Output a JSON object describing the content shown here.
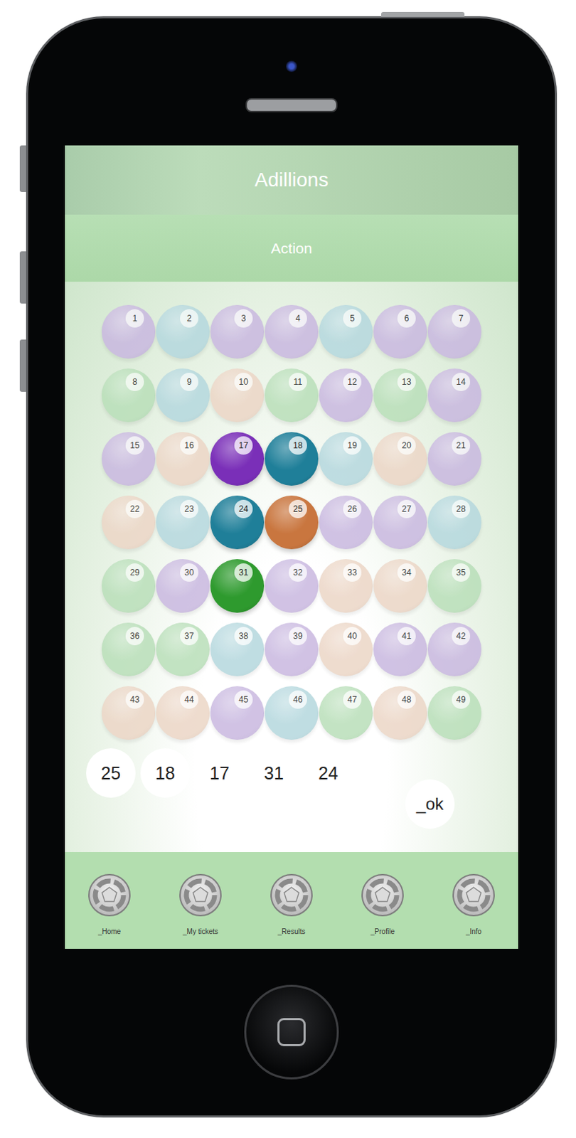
{
  "app": {
    "title": "Adillions",
    "subtitle": "Action"
  },
  "balls": [
    {
      "number": "1",
      "color": "#c9b8e0",
      "selected": false
    },
    {
      "number": "2",
      "color": "#b5d8de",
      "selected": false
    },
    {
      "number": "3",
      "color": "#c9b8e0",
      "selected": false
    },
    {
      "number": "4",
      "color": "#c9b8e0",
      "selected": false
    },
    {
      "number": "5",
      "color": "#b5d8de",
      "selected": false
    },
    {
      "number": "6",
      "color": "#c9b8e0",
      "selected": false
    },
    {
      "number": "7",
      "color": "#c9b8e0",
      "selected": false
    },
    {
      "number": "8",
      "color": "#b9dfb9",
      "selected": false
    },
    {
      "number": "9",
      "color": "#b5d8de",
      "selected": false
    },
    {
      "number": "10",
      "color": "#ecd6c6",
      "selected": false
    },
    {
      "number": "11",
      "color": "#b9dfb9",
      "selected": false
    },
    {
      "number": "12",
      "color": "#c9b8e0",
      "selected": false
    },
    {
      "number": "13",
      "color": "#b9dfb9",
      "selected": false
    },
    {
      "number": "14",
      "color": "#c9b8e0",
      "selected": false
    },
    {
      "number": "15",
      "color": "#c9b8e0",
      "selected": false
    },
    {
      "number": "16",
      "color": "#ecd6c6",
      "selected": false
    },
    {
      "number": "17",
      "color": "#7a2fb8",
      "selected": true
    },
    {
      "number": "18",
      "color": "#1f7f99",
      "selected": true
    },
    {
      "number": "19",
      "color": "#b5d8de",
      "selected": false
    },
    {
      "number": "20",
      "color": "#ecd6c6",
      "selected": false
    },
    {
      "number": "21",
      "color": "#c9b8e0",
      "selected": false
    },
    {
      "number": "22",
      "color": "#ecd6c6",
      "selected": false
    },
    {
      "number": "23",
      "color": "#b5d8de",
      "selected": false
    },
    {
      "number": "24",
      "color": "#1f7f99",
      "selected": true
    },
    {
      "number": "25",
      "color": "#c9763f",
      "selected": true
    },
    {
      "number": "26",
      "color": "#c9b8e0",
      "selected": false
    },
    {
      "number": "27",
      "color": "#c9b8e0",
      "selected": false
    },
    {
      "number": "28",
      "color": "#b5d8de",
      "selected": false
    },
    {
      "number": "29",
      "color": "#b9dfb9",
      "selected": false
    },
    {
      "number": "30",
      "color": "#c9b8e0",
      "selected": false
    },
    {
      "number": "31",
      "color": "#2e9a2e",
      "selected": true
    },
    {
      "number": "32",
      "color": "#c9b8e0",
      "selected": false
    },
    {
      "number": "33",
      "color": "#ecd6c6",
      "selected": false
    },
    {
      "number": "34",
      "color": "#ecd6c6",
      "selected": false
    },
    {
      "number": "35",
      "color": "#b9dfb9",
      "selected": false
    },
    {
      "number": "36",
      "color": "#b9dfb9",
      "selected": false
    },
    {
      "number": "37",
      "color": "#b9dfb9",
      "selected": false
    },
    {
      "number": "38",
      "color": "#b5d8de",
      "selected": false
    },
    {
      "number": "39",
      "color": "#c9b8e0",
      "selected": false
    },
    {
      "number": "40",
      "color": "#ecd6c6",
      "selected": false
    },
    {
      "number": "41",
      "color": "#c9b8e0",
      "selected": false
    },
    {
      "number": "42",
      "color": "#c9b8e0",
      "selected": false
    },
    {
      "number": "43",
      "color": "#ecd6c6",
      "selected": false
    },
    {
      "number": "44",
      "color": "#ecd6c6",
      "selected": false
    },
    {
      "number": "45",
      "color": "#c9b8e0",
      "selected": false
    },
    {
      "number": "46",
      "color": "#b5d8de",
      "selected": false
    },
    {
      "number": "47",
      "color": "#b9dfb9",
      "selected": false
    },
    {
      "number": "48",
      "color": "#ecd6c6",
      "selected": false
    },
    {
      "number": "49",
      "color": "#b9dfb9",
      "selected": false
    }
  ],
  "picks": [
    "25",
    "18",
    "17",
    "31",
    "24"
  ],
  "ok_button": "_ok",
  "nav": [
    {
      "label": "_Home"
    },
    {
      "label": "_My tickets"
    },
    {
      "label": "_Results"
    },
    {
      "label": "_Profile"
    },
    {
      "label": "_Info"
    }
  ]
}
